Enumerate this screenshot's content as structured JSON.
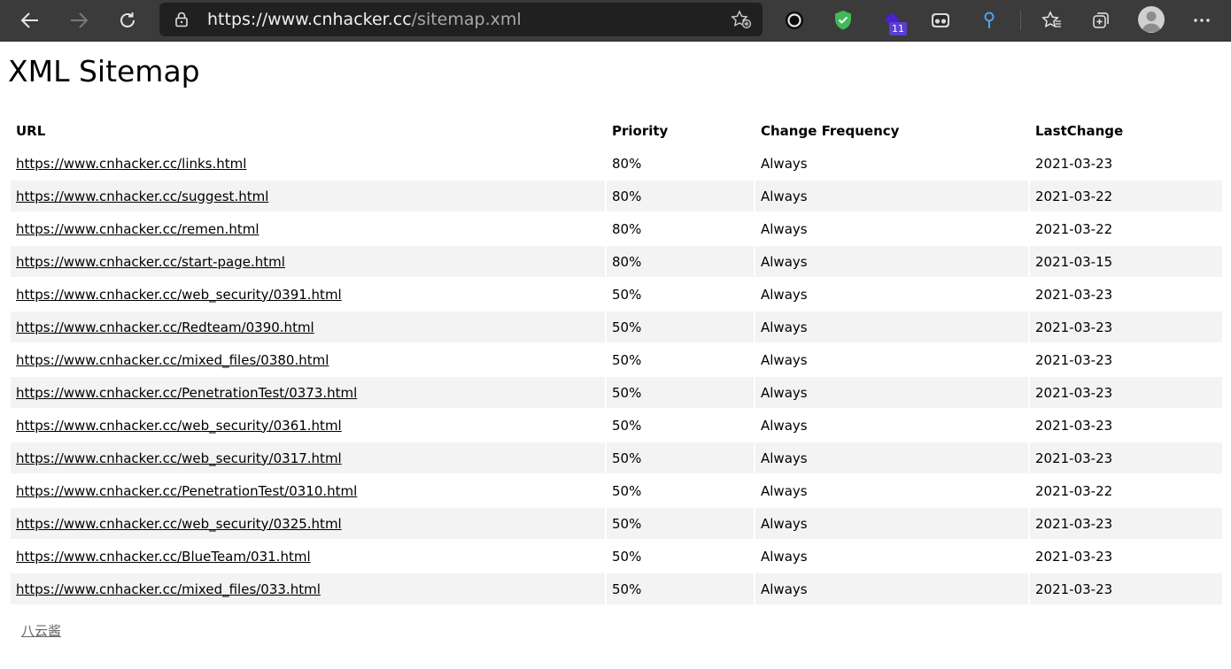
{
  "browser": {
    "url_host": "https://www.cnhacker.cc",
    "url_path": "/sitemap.xml",
    "extension_badge": "11",
    "icons": [
      "back-icon",
      "forward-icon",
      "refresh-icon",
      "lock-icon",
      "add-favorite-icon",
      "extension-circle-icon",
      "extension-shield-icon",
      "extension-badge-icon",
      "extension-mask-icon",
      "extension-pin-icon",
      "favorites-icon",
      "collections-icon",
      "profile-avatar",
      "more-options-icon"
    ]
  },
  "page": {
    "title": "XML Sitemap",
    "headers": {
      "url": "URL",
      "priority": "Priority",
      "change_frequency": "Change Frequency",
      "last_change": "LastChange"
    },
    "rows": [
      {
        "url": "https://www.cnhacker.cc/links.html",
        "priority": "80%",
        "frequency": "Always",
        "lastchange": "2021-03-23"
      },
      {
        "url": "https://www.cnhacker.cc/suggest.html",
        "priority": "80%",
        "frequency": "Always",
        "lastchange": "2021-03-22"
      },
      {
        "url": "https://www.cnhacker.cc/remen.html",
        "priority": "80%",
        "frequency": "Always",
        "lastchange": "2021-03-22"
      },
      {
        "url": "https://www.cnhacker.cc/start-page.html",
        "priority": "80%",
        "frequency": "Always",
        "lastchange": "2021-03-15"
      },
      {
        "url": "https://www.cnhacker.cc/web_security/0391.html",
        "priority": "50%",
        "frequency": "Always",
        "lastchange": "2021-03-23"
      },
      {
        "url": "https://www.cnhacker.cc/Redteam/0390.html",
        "priority": "50%",
        "frequency": "Always",
        "lastchange": "2021-03-23"
      },
      {
        "url": "https://www.cnhacker.cc/mixed_files/0380.html",
        "priority": "50%",
        "frequency": "Always",
        "lastchange": "2021-03-23"
      },
      {
        "url": "https://www.cnhacker.cc/PenetrationTest/0373.html",
        "priority": "50%",
        "frequency": "Always",
        "lastchange": "2021-03-23"
      },
      {
        "url": "https://www.cnhacker.cc/web_security/0361.html",
        "priority": "50%",
        "frequency": "Always",
        "lastchange": "2021-03-23"
      },
      {
        "url": "https://www.cnhacker.cc/web_security/0317.html",
        "priority": "50%",
        "frequency": "Always",
        "lastchange": "2021-03-23"
      },
      {
        "url": "https://www.cnhacker.cc/PenetrationTest/0310.html",
        "priority": "50%",
        "frequency": "Always",
        "lastchange": "2021-03-22"
      },
      {
        "url": "https://www.cnhacker.cc/web_security/0325.html",
        "priority": "50%",
        "frequency": "Always",
        "lastchange": "2021-03-23"
      },
      {
        "url": "https://www.cnhacker.cc/BlueTeam/031.html",
        "priority": "50%",
        "frequency": "Always",
        "lastchange": "2021-03-23"
      },
      {
        "url": "https://www.cnhacker.cc/mixed_files/033.html",
        "priority": "50%",
        "frequency": "Always",
        "lastchange": "2021-03-23"
      }
    ],
    "footer_link": "八云酱"
  },
  "colors": {
    "toolbar_bg": "#3b3b3b",
    "addressbar_bg": "#202020",
    "row_stripe": "#f3f3f3",
    "shield_green": "#3fba5a",
    "badge_purple": "#5b3fd3",
    "pin_blue": "#4aa3f0"
  }
}
